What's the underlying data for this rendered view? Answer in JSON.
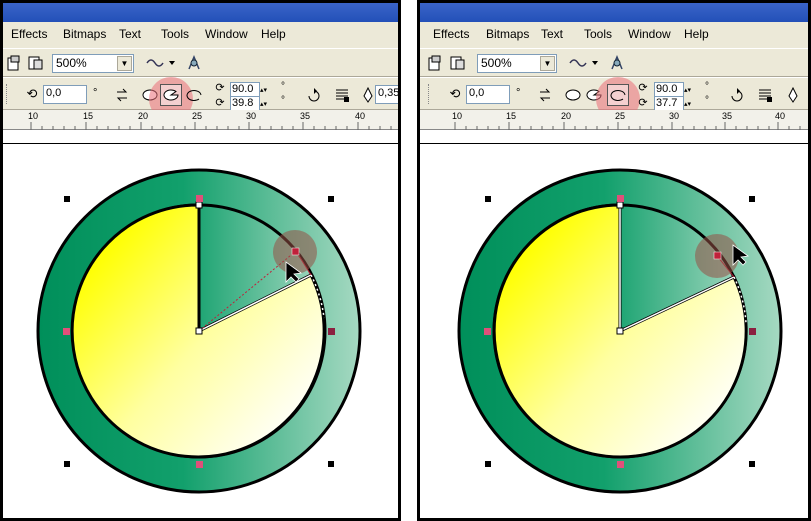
{
  "menu": [
    "Effects",
    "Bitmaps",
    "Text",
    "Tools",
    "Window",
    "Help"
  ],
  "zoom": "500%",
  "position_field": "0,0",
  "degree_symbol": "°",
  "ruler_labels": [
    "10",
    "15",
    "20",
    "25",
    "30",
    "35",
    "40"
  ],
  "left": {
    "start_angle": "90.0",
    "end_angle": "39.8",
    "outline_width": "0,35",
    "active_tool": "pie"
  },
  "right": {
    "start_angle": "90.0",
    "end_angle": "37.7",
    "active_tool": "arc"
  },
  "colors": {
    "ring_dark": "#008f5a",
    "ring_light": "#9fd6bd",
    "yellow": "#ffff00",
    "cream": "#ffffe8",
    "node_pink": "#e0507a",
    "node_maroon": "#8b2040",
    "highlight": "#ec6e78"
  }
}
